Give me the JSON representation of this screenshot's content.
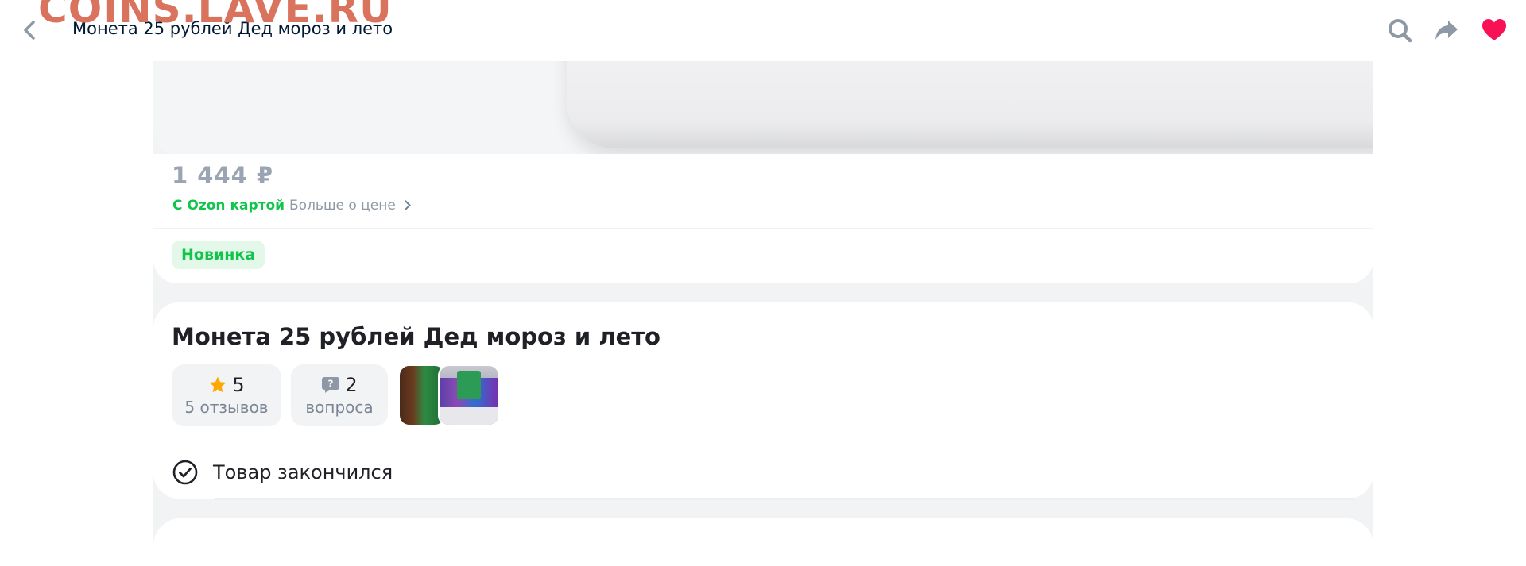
{
  "watermark": "COINS.LAVE.RU",
  "header": {
    "title": "Монета 25 рублей Дед мороз и лето",
    "icons": [
      "back-arrow-icon",
      "search-icon",
      "share-icon",
      "heart-icon"
    ],
    "heart_color": "#f91155"
  },
  "price": {
    "value": "1 444 ₽",
    "ozon_card_label": "С Ozon картой",
    "more_label": "Больше о цене"
  },
  "badge": {
    "label": "Новинка"
  },
  "product": {
    "name": "Монета 25 рублей Дед мороз и лето",
    "rating": {
      "value": "5",
      "reviews_label": "5 отзывов",
      "star_color": "#ffa800"
    },
    "questions": {
      "count": "2",
      "label": "вопроса"
    },
    "stock_status": "Товар закончился"
  },
  "colors": {
    "accent_green": "#10c44c",
    "price_gray": "#9aa4b2",
    "page_bg": "#f2f3f5"
  }
}
